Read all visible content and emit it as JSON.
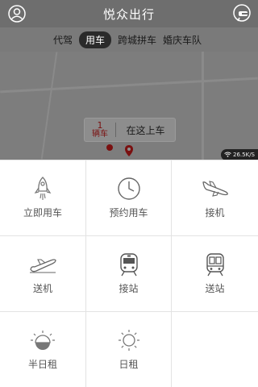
{
  "header": {
    "title": "悦众出行",
    "avatar_icon": "user-icon",
    "chat_icon": "chat-icon"
  },
  "categories": [
    {
      "label": "代驾",
      "active": false
    },
    {
      "label": "用车",
      "active": true
    },
    {
      "label": "跨城拼车",
      "active": false
    },
    {
      "label": "婚庆车队",
      "active": false
    }
  ],
  "map": {
    "car_count_number": "1",
    "car_count_unit": "辆车",
    "pickup_label": "在这上车",
    "net_speed": "26.5K/S"
  },
  "services": [
    {
      "label": "立即用车",
      "icon": "rocket-icon"
    },
    {
      "label": "预约用车",
      "icon": "clock-icon"
    },
    {
      "label": "接机",
      "icon": "landing-plane-icon"
    },
    {
      "label": "送机",
      "icon": "takeoff-plane-icon"
    },
    {
      "label": "接站",
      "icon": "train-icon"
    },
    {
      "label": "送站",
      "icon": "train-icon"
    },
    {
      "label": "半日租",
      "icon": "half-sun-icon"
    },
    {
      "label": "日租",
      "icon": "sun-icon"
    }
  ],
  "colors": {
    "header_bg": "#6e6e6e",
    "accent": "#7a1010",
    "text_gray": "#555555"
  }
}
